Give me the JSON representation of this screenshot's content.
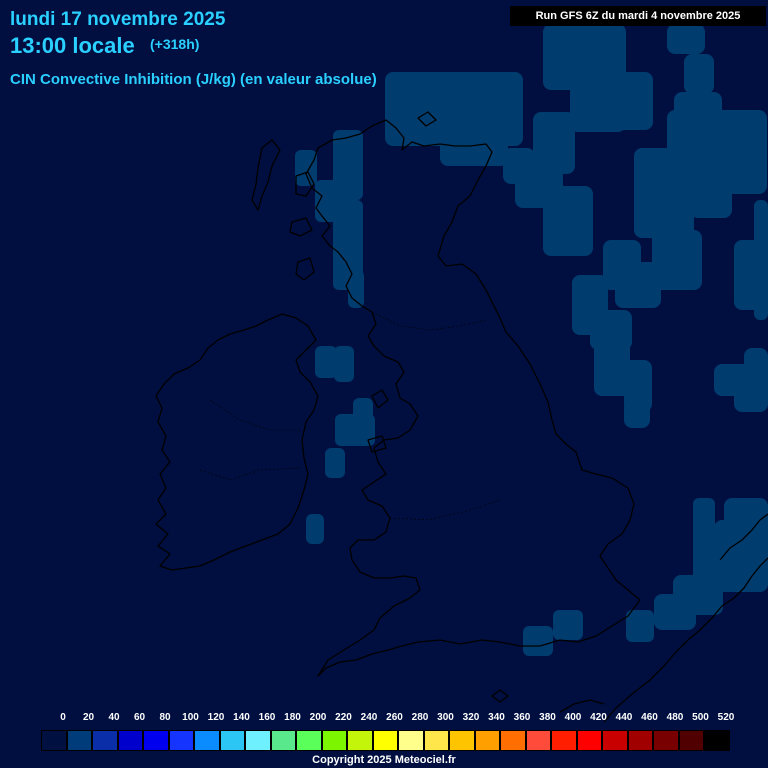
{
  "header": {
    "date": "lundi 17 novembre 2025",
    "time": "13:00 locale",
    "offset": "(+318h)",
    "parameter": "CIN Convective Inhibition (J/kg) (en valeur absolue)",
    "run": "Run GFS 6Z du mardi 4 novembre 2025"
  },
  "legend": {
    "ticks": [
      "0",
      "20",
      "40",
      "60",
      "80",
      "100",
      "120",
      "140",
      "160",
      "180",
      "200",
      "220",
      "240",
      "260",
      "280",
      "300",
      "320",
      "340",
      "360",
      "380",
      "400",
      "420",
      "440",
      "460",
      "480",
      "500",
      "520"
    ],
    "colors": [
      "#001040",
      "#003c7a",
      "#0a2da8",
      "#0000cc",
      "#0000ee",
      "#1535ff",
      "#0a8cff",
      "#2cc6f5",
      "#6ef0ff",
      "#5ae88c",
      "#5aff5a",
      "#7cf500",
      "#c3f50a",
      "#ffff00",
      "#ffff8c",
      "#ffe64b",
      "#ffc400",
      "#ff9f00",
      "#ff6e00",
      "#ff4c3a",
      "#ff1e00",
      "#ff0000",
      "#c80000",
      "#a00000",
      "#780000",
      "#500000",
      "#000000"
    ]
  },
  "map": {
    "region": "British Isles",
    "background_color": "#000f40",
    "cin_patch_color": "#003c6e",
    "coastline_color": "#000000"
  },
  "footer": {
    "copyright": "Copyright 2025 Meteociel.fr"
  }
}
